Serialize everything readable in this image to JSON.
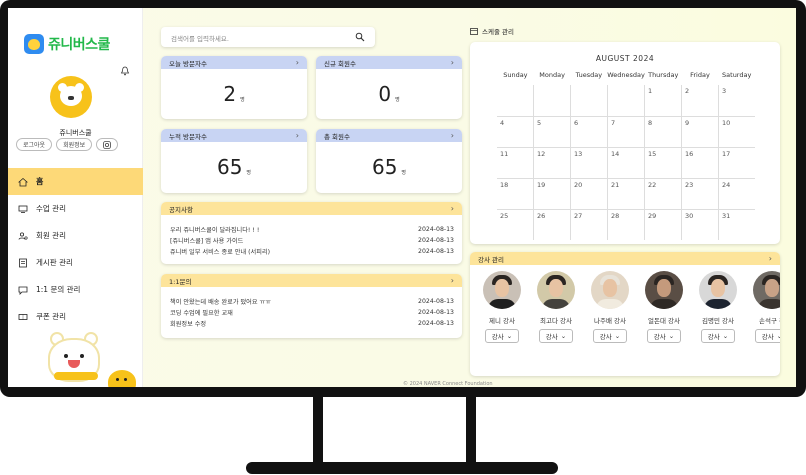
{
  "brand": {
    "logo_text": "쥬니버스쿨"
  },
  "profile": {
    "name": "쥬니버스쿨",
    "logout": "로그아웃",
    "member_info": "회원정보"
  },
  "sidebar": {
    "items": [
      {
        "label": "홈",
        "icon": "home-icon",
        "active": true
      },
      {
        "label": "수업 관리",
        "icon": "monitor-icon"
      },
      {
        "label": "회원 관리",
        "icon": "users-icon"
      },
      {
        "label": "게시판 관리",
        "icon": "board-icon"
      },
      {
        "label": "1:1 문의 관리",
        "icon": "chat-icon"
      },
      {
        "label": "쿠폰 관리",
        "icon": "coupon-icon"
      }
    ]
  },
  "search": {
    "placeholder": "검색어를 입력하세요."
  },
  "stats": [
    {
      "label": "오늘 방문자수",
      "value": "2",
      "unit": "명"
    },
    {
      "label": "신규 회원수",
      "value": "0",
      "unit": "명"
    },
    {
      "label": "누적 방문자수",
      "value": "65",
      "unit": "명"
    },
    {
      "label": "총 회원수",
      "value": "65",
      "unit": "명"
    }
  ],
  "notices": {
    "title": "공지사항",
    "rows": [
      {
        "text": "우리 쥬니버스쿨이 달라집니다! ! !",
        "date": "2024-08-13"
      },
      {
        "text": "[쥬니버스쿨] 앱 사용 가이드",
        "date": "2024-08-13"
      },
      {
        "text": "쥬니버 일부 서비스 종료 안내 (서피리)",
        "date": "2024-08-13"
      }
    ]
  },
  "inquiries": {
    "title": "1:1문의",
    "rows": [
      {
        "text": "책이 안왔는데 배송 완료가 떴어요 ㅠㅠ",
        "date": "2024-08-13"
      },
      {
        "text": "코딩 수업에 필요한 교재",
        "date": "2024-08-13"
      },
      {
        "text": "회원정보 수정",
        "date": "2024-08-13"
      }
    ]
  },
  "schedule": {
    "title": "스케줄 관리",
    "month": "AUGUST 2024",
    "weekdays": [
      "Sunday",
      "Monday",
      "Tuesday",
      "Wednesday",
      "Thursday",
      "Friday",
      "Saturday"
    ],
    "weeks": [
      [
        "",
        "",
        "",
        "",
        "1",
        "2",
        "3"
      ],
      [
        "4",
        "5",
        "6",
        "7",
        "8",
        "9",
        "10"
      ],
      [
        "11",
        "12",
        "13",
        "14",
        "15",
        "16",
        "17"
      ],
      [
        "18",
        "19",
        "20",
        "21",
        "22",
        "23",
        "24"
      ],
      [
        "25",
        "26",
        "27",
        "28",
        "29",
        "30",
        "31"
      ]
    ]
  },
  "teachers": {
    "title": "강사 관리",
    "select_label": "강사",
    "items": [
      {
        "name": "제니 강사"
      },
      {
        "name": "최고다 강사"
      },
      {
        "name": "나주배 강사"
      },
      {
        "name": "얼돈대 강사"
      },
      {
        "name": "김명민 강사"
      },
      {
        "name": "손석구 강"
      }
    ]
  },
  "footer": "© 2024 NAVER Connect Foundation",
  "colors": {
    "accent_yellow": "#fdd978",
    "stat_header": "#c8d4f3",
    "list_header": "#fde49a"
  }
}
